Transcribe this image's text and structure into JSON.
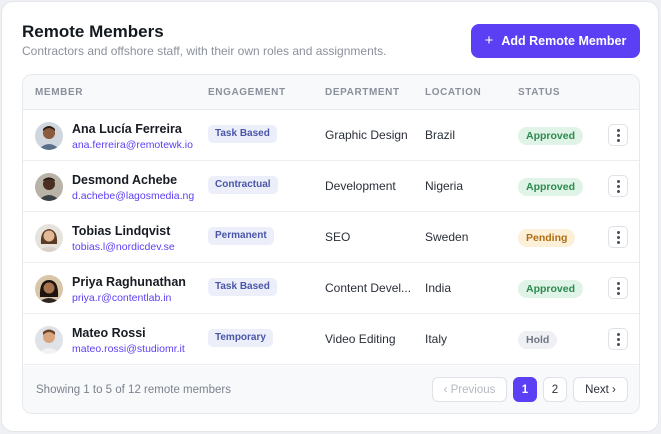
{
  "header": {
    "title": "Remote Members",
    "subtitle": "Contractors and offshore staff, with their own roles and assignments.",
    "add_button_label": "Add Remote Member",
    "add_button_icon": "plus-icon"
  },
  "columns": [
    "MEMBER",
    "ENGAGEMENT",
    "DEPARTMENT",
    "LOCATION",
    "STATUS"
  ],
  "members": [
    {
      "name": "Ana Lucía Ferreira",
      "email": "ana.ferreira@remotewk.io",
      "engagement": "Task Based",
      "department": "Graphic Design",
      "location": "Brazil",
      "status": "Approved"
    },
    {
      "name": "Desmond Achebe",
      "email": "d.achebe@lagosmedia.ng",
      "engagement": "Contractual",
      "department": "Development",
      "location": "Nigeria",
      "status": "Approved"
    },
    {
      "name": "Tobias Lindqvist",
      "email": "tobias.l@nordicdev.se",
      "engagement": "Permanent",
      "department": "SEO",
      "location": "Sweden",
      "status": "Pending"
    },
    {
      "name": "Priya Raghunathan",
      "email": "priya.r@contentlab.in",
      "engagement": "Task Based",
      "department": "Content Devel...",
      "location": "India",
      "status": "Approved"
    },
    {
      "name": "Mateo Rossi",
      "email": "mateo.rossi@studiomr.it",
      "engagement": "Temporary",
      "department": "Video Editing",
      "location": "Italy",
      "status": "Hold"
    }
  ],
  "footer": {
    "showing_text": "Showing 1 to 5 of 12 remote members",
    "prev_label": "‹ Previous",
    "pages": [
      "1",
      "2"
    ],
    "current_page": "1",
    "next_label": "Next ›"
  },
  "colors": {
    "accent": "#5b3ff5",
    "approved": "#2b8a4e",
    "pending": "#b06d10",
    "hold": "#6f7684"
  }
}
